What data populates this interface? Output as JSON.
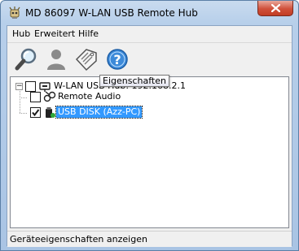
{
  "window": {
    "title": "MD 86097 W-LAN USB Remote Hub"
  },
  "menu": {
    "items": [
      "Hub",
      "Erweitert",
      "Hilfe"
    ]
  },
  "toolbar": {
    "buttons": [
      {
        "icon": "magnifier-search-icon"
      },
      {
        "icon": "user-icon"
      },
      {
        "icon": "properties-tag-icon"
      },
      {
        "icon": "help-icon"
      }
    ],
    "tooltip": "Eigenschaften"
  },
  "tree": {
    "hub": {
      "label": "W-LAN USB Hub: 192.168.2.1",
      "checked": false
    },
    "devices": [
      {
        "label": "Remote Audio",
        "checked": false,
        "selected": false
      },
      {
        "label": "USB DISK (Azz-PC)",
        "checked": true,
        "selected": true
      }
    ]
  },
  "status": {
    "text": "Geräteeigenschaften anzeigen"
  },
  "colors": {
    "selection": "#3399ff",
    "close_button": "#c13d24"
  }
}
